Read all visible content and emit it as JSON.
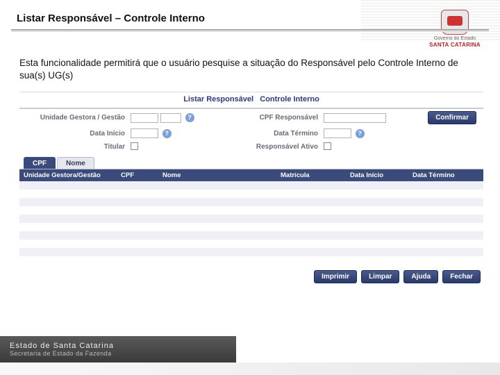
{
  "header": {
    "title": "Listar Responsável – Controle Interno",
    "crest_sub": "Governo do Estado",
    "crest_state": "SANTA CATARINA"
  },
  "description": "Esta funcionalidade permitirá que o usuário pesquise a situação do Responsável pelo Controle Interno de sua(s) UG(s)",
  "app": {
    "title_main": "Listar Responsável",
    "title_sub": "Controle Interno",
    "labels": {
      "unidade": "Unidade Gestora / Gestão",
      "cpf": "CPF Responsável",
      "data_inicio": "Data Início",
      "data_termino": "Data Término",
      "titular": "Titular",
      "resp_ativo": "Responsável Ativo"
    },
    "buttons": {
      "confirmar": "Confirmar",
      "imprimir": "Imprimir",
      "limpar": "Limpar",
      "ajuda": "Ajuda",
      "fechar": "Fechar"
    },
    "tabs": {
      "cpf": "CPF",
      "nome": "Nome"
    },
    "grid_headers": {
      "ug": "Unidade Gestora/Gestão",
      "cpf": "CPF",
      "nome": "Nome",
      "matricula": "Matrícula",
      "data_inicio": "Data Início",
      "data_termino": "Data Término"
    }
  },
  "footer": {
    "line1": "Estado de Santa Catarina",
    "line2": "Secretaria de Estado da Fazenda"
  }
}
